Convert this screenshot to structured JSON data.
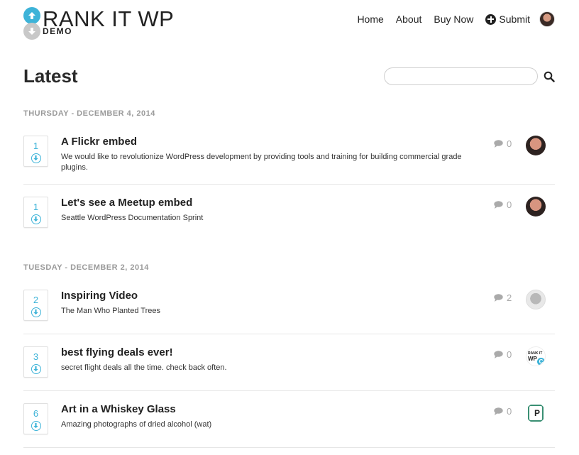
{
  "brand": {
    "name": "RANK IT WP",
    "tagline": "DEMO"
  },
  "nav": {
    "items": [
      {
        "label": "Home"
      },
      {
        "label": "About"
      },
      {
        "label": "Buy Now"
      },
      {
        "label": "Submit"
      }
    ]
  },
  "page": {
    "title": "Latest"
  },
  "search": {
    "placeholder": "",
    "value": ""
  },
  "days": [
    {
      "heading": "THURSDAY - DECEMBER 4, 2014",
      "posts": [
        {
          "votes": "1",
          "title": "A Flickr embed",
          "excerpt": "We would like to revolutionize WordPress development by providing tools and training for building commercial grade plugins.",
          "comments": "0",
          "avatar": "user-photo"
        },
        {
          "votes": "1",
          "title": "Let's see a Meetup embed",
          "excerpt": "Seattle WordPress Documentation Sprint",
          "comments": "0",
          "avatar": "user-photo"
        }
      ]
    },
    {
      "heading": "TUESDAY - DECEMBER 2, 2014",
      "posts": [
        {
          "votes": "2",
          "title": "Inspiring Video",
          "excerpt": "The Man Who Planted Trees",
          "comments": "2",
          "avatar": "user-grey"
        },
        {
          "votes": "3",
          "title": "best flying deals ever!",
          "excerpt": "secret flight deals all the time. check back often.",
          "comments": "0",
          "avatar": "rankit-logo"
        },
        {
          "votes": "6",
          "title": "Art in a Whiskey Glass",
          "excerpt": "Amazing photographs of dried alcohol (wat)",
          "comments": "0",
          "avatar": "p-badge"
        }
      ]
    }
  ],
  "avatar_labels": {
    "rankit_top": "RANK IT",
    "rankit_wp": "WP",
    "rankit_c": "C",
    "badge_p": "P"
  },
  "colors": {
    "accent": "#3db3d8",
    "muted": "#9a9a9a",
    "text": "#222222"
  }
}
